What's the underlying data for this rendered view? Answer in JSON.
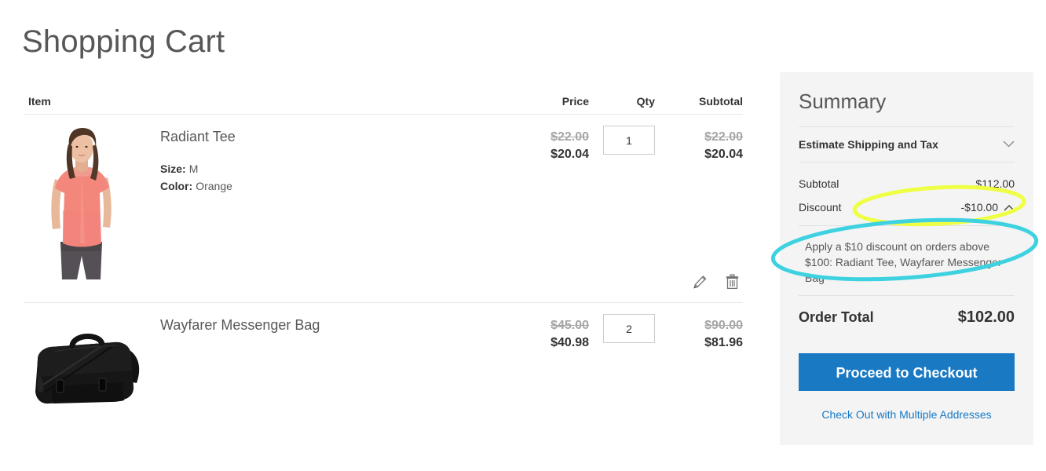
{
  "page": {
    "title": "Shopping Cart"
  },
  "cart": {
    "headers": {
      "item": "Item",
      "price": "Price",
      "qty": "Qty",
      "subtotal": "Subtotal"
    },
    "rows": [
      {
        "name": "Radiant Tee",
        "image_alt": "radiant-tee-thumbnail",
        "options": [
          {
            "label": "Size:",
            "value": "M"
          },
          {
            "label": "Color:",
            "value": "Orange"
          }
        ],
        "price_original": "$22.00",
        "price_current": "$20.04",
        "qty": "1",
        "subtotal_original": "$22.00",
        "subtotal_current": "$20.04",
        "actions": {
          "edit": "edit-item",
          "remove": "remove-item"
        }
      },
      {
        "name": "Wayfarer Messenger Bag",
        "image_alt": "wayfarer-messenger-bag-thumbnail",
        "options": [],
        "price_original": "$45.00",
        "price_current": "$40.98",
        "qty": "2",
        "subtotal_original": "$90.00",
        "subtotal_current": "$81.96",
        "actions": {
          "edit": "edit-item",
          "remove": "remove-item"
        }
      }
    ]
  },
  "summary": {
    "title": "Summary",
    "estimate_shipping_label": "Estimate Shipping and Tax",
    "subtotal_label": "Subtotal",
    "subtotal_value": "$112.00",
    "discount_label": "Discount",
    "discount_value": "-$10.00",
    "discount_note": "Apply a $10 discount on orders above $100: Radiant Tee, Wayfarer Messenger Bag",
    "order_total_label": "Order Total",
    "order_total_value": "$102.00",
    "checkout_button": "Proceed to Checkout",
    "multiple_addresses_link": "Check Out with Multiple Addresses"
  },
  "colors": {
    "accent_blue": "#1979c3",
    "panel_bg": "#f4f4f4",
    "old_price_gray": "#a6a6a6",
    "annotation_yellow": "#eeff44",
    "annotation_cyan": "#3ed1e0"
  },
  "annotations": [
    {
      "name": "discount-value-highlight",
      "shape": "ellipse",
      "color": "#eeff44"
    },
    {
      "name": "discount-note-highlight",
      "shape": "ellipse",
      "color": "#3ed1e0"
    }
  ]
}
